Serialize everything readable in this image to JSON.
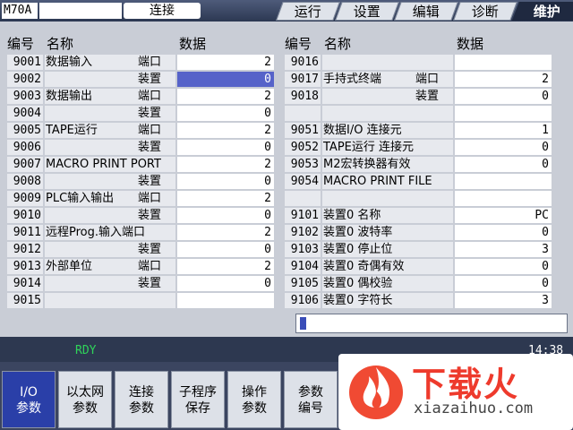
{
  "header": {
    "model": "M70A",
    "mode": "连接",
    "tabs": [
      "运行",
      "设置",
      "编辑",
      "诊断",
      "维护"
    ],
    "active_tab": "维护"
  },
  "columns": {
    "left": {
      "no": "编号",
      "name": "名称",
      "data": "数据"
    },
    "right": {
      "no": "编号",
      "name": "名称",
      "data": "数据"
    }
  },
  "left_params": [
    {
      "no": "9001",
      "name": "数据输入",
      "sub": "端口",
      "value": "2"
    },
    {
      "no": "9002",
      "name": "",
      "sub": "装置",
      "value": "0",
      "selected": true
    },
    {
      "no": "9003",
      "name": "数据输出",
      "sub": "端口",
      "value": "2"
    },
    {
      "no": "9004",
      "name": "",
      "sub": "装置",
      "value": "0"
    },
    {
      "no": "9005",
      "name": "TAPE运行",
      "sub": "端口",
      "value": "2"
    },
    {
      "no": "9006",
      "name": "",
      "sub": "装置",
      "value": "0"
    },
    {
      "no": "9007",
      "name": "MACRO PRINT PORT",
      "sub": "",
      "value": "2"
    },
    {
      "no": "9008",
      "name": "",
      "sub": "装置",
      "value": "0"
    },
    {
      "no": "9009",
      "name": "PLC输入输出",
      "sub": "端口",
      "value": "2"
    },
    {
      "no": "9010",
      "name": "",
      "sub": "装置",
      "value": "0"
    },
    {
      "no": "9011",
      "name": "远程Prog.输入端口",
      "sub": "",
      "value": "2"
    },
    {
      "no": "9012",
      "name": "",
      "sub": "装置",
      "value": "0"
    },
    {
      "no": "9013",
      "name": "外部单位",
      "sub": "端口",
      "value": "2"
    },
    {
      "no": "9014",
      "name": "",
      "sub": "装置",
      "value": "0"
    },
    {
      "no": "9015",
      "name": "",
      "sub": "",
      "value": ""
    }
  ],
  "right_params": [
    {
      "no": "9016",
      "name": "",
      "sub": "",
      "value": ""
    },
    {
      "no": "9017",
      "name": "手持式终端",
      "sub": "端口",
      "value": "2"
    },
    {
      "no": "9018",
      "name": "",
      "sub": "装置",
      "value": "0"
    },
    {
      "no": "",
      "name": "",
      "sub": "",
      "value": "",
      "blank": true
    },
    {
      "no": "9051",
      "name": "数据I/O 连接元",
      "sub": "",
      "value": "1"
    },
    {
      "no": "9052",
      "name": "TAPE运行 连接元",
      "sub": "",
      "value": "0"
    },
    {
      "no": "9053",
      "name": "M2宏转换器有效",
      "sub": "",
      "value": "0"
    },
    {
      "no": "9054",
      "name": "MACRO PRINT FILE",
      "sub": "",
      "value": ""
    },
    {
      "no": "",
      "name": "",
      "sub": "",
      "value": "",
      "blank": true
    },
    {
      "no": "9101",
      "name": "装置0 名称",
      "sub": "",
      "value": "PC"
    },
    {
      "no": "9102",
      "name": "装置0 波特率",
      "sub": "",
      "value": "0"
    },
    {
      "no": "9103",
      "name": "装置0 停止位",
      "sub": "",
      "value": "3"
    },
    {
      "no": "9104",
      "name": "装置0 奇偶有效",
      "sub": "",
      "value": "0"
    },
    {
      "no": "9105",
      "name": "装置0 偶校验",
      "sub": "",
      "value": "0"
    },
    {
      "no": "9106",
      "name": "装置0 字符长",
      "sub": "",
      "value": "3"
    }
  ],
  "status": {
    "ready": "RDY",
    "time": "14:38"
  },
  "softkeys": [
    {
      "l1": "I/O",
      "l2": "参数",
      "active": true
    },
    {
      "l1": "以太网",
      "l2": "参数"
    },
    {
      "l1": "连接",
      "l2": "参数"
    },
    {
      "l1": "子程序",
      "l2": "保存"
    },
    {
      "l1": "操作",
      "l2": "参数"
    },
    {
      "l1": "参数",
      "l2": "编号"
    }
  ],
  "watermark": {
    "brand": "下载火",
    "url": "xiazaihuo.com"
  },
  "colors": {
    "selected": "#5663c9",
    "ready": "#2fd35a",
    "brand": "#ee3a2c"
  }
}
